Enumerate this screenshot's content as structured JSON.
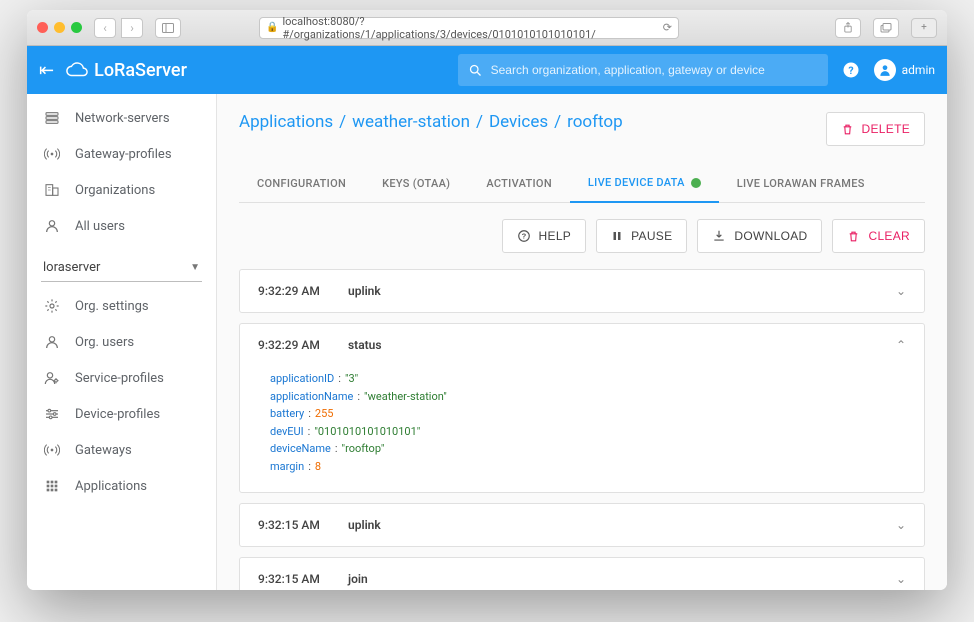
{
  "browser": {
    "url": "localhost:8080/?#/organizations/1/applications/3/devices/0101010101010101/"
  },
  "brand": "LoRaServer",
  "search": {
    "placeholder": "Search organization, application, gateway or device"
  },
  "header_user": "admin",
  "sidebar_top": [
    {
      "label": "Network-servers",
      "icon": "servers"
    },
    {
      "label": "Gateway-profiles",
      "icon": "antenna"
    },
    {
      "label": "Organizations",
      "icon": "org"
    },
    {
      "label": "All users",
      "icon": "user"
    }
  ],
  "org_selected": "loraserver",
  "sidebar_org": [
    {
      "label": "Org. settings",
      "icon": "gear"
    },
    {
      "label": "Org. users",
      "icon": "user"
    },
    {
      "label": "Service-profiles",
      "icon": "service"
    },
    {
      "label": "Device-profiles",
      "icon": "sliders"
    },
    {
      "label": "Gateways",
      "icon": "antenna"
    },
    {
      "label": "Applications",
      "icon": "apps"
    }
  ],
  "breadcrumb": [
    "Applications",
    "weather-station",
    "Devices",
    "rooftop"
  ],
  "delete_label": "DELETE",
  "tabs": [
    {
      "label": "CONFIGURATION"
    },
    {
      "label": "KEYS (OTAA)"
    },
    {
      "label": "ACTIVATION"
    },
    {
      "label": "LIVE DEVICE DATA",
      "active": true,
      "dot": true
    },
    {
      "label": "LIVE LORAWAN FRAMES"
    }
  ],
  "actions": {
    "help": "HELP",
    "pause": "PAUSE",
    "download": "DOWNLOAD",
    "clear": "CLEAR"
  },
  "events": [
    {
      "time": "9:32:29 AM",
      "type": "uplink",
      "expanded": false
    },
    {
      "time": "9:32:29 AM",
      "type": "status",
      "expanded": true,
      "payload": [
        {
          "k": "applicationID",
          "v": "\"3\"",
          "vt": "str"
        },
        {
          "k": "applicationName",
          "v": "\"weather-station\"",
          "vt": "str"
        },
        {
          "k": "battery",
          "v": "255",
          "vt": "num"
        },
        {
          "k": "devEUI",
          "v": "\"0101010101010101\"",
          "vt": "str"
        },
        {
          "k": "deviceName",
          "v": "\"rooftop\"",
          "vt": "str"
        },
        {
          "k": "margin",
          "v": "8",
          "vt": "num"
        }
      ]
    },
    {
      "time": "9:32:15 AM",
      "type": "uplink",
      "expanded": false
    },
    {
      "time": "9:32:15 AM",
      "type": "join",
      "expanded": false
    }
  ]
}
